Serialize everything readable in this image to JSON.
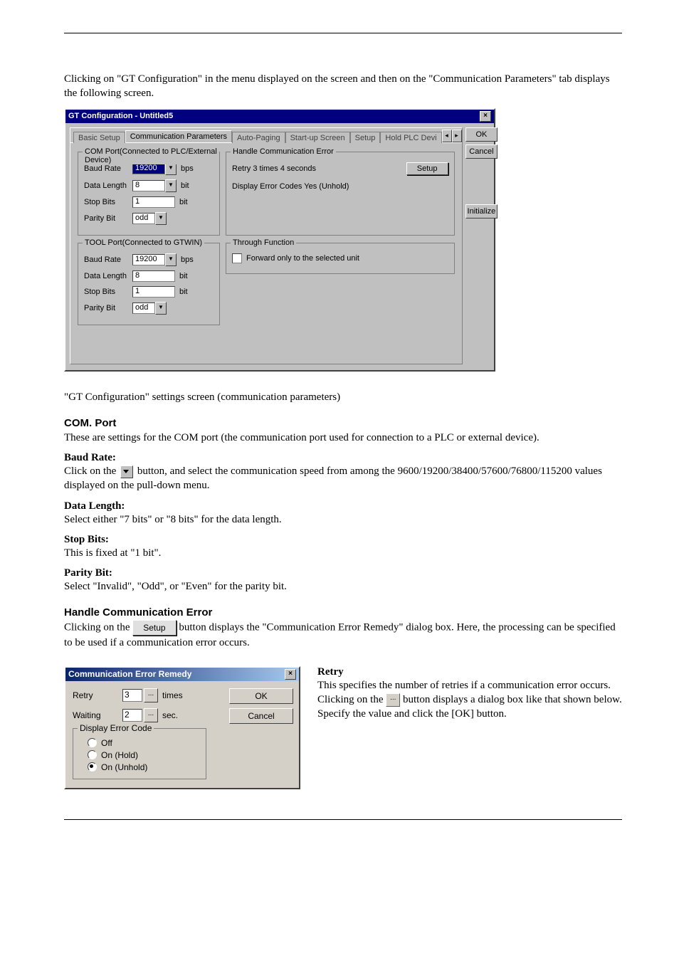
{
  "intro": {
    "p1": "Clicking on \"GT Configuration\" in the menu displayed on the screen and then on the \"Communication Parameters\" tab displays the following screen.",
    "caption": "\"GT Configuration\" settings screen (communication parameters)"
  },
  "dialog1": {
    "title": "GT Configuration - Untitled5",
    "tabs": [
      "Basic Setup",
      "Communication Parameters",
      "Auto-Paging",
      "Start-up Screen",
      "Setup",
      "Hold PLC Devi"
    ],
    "btn_ok": "OK",
    "btn_cancel": "Cancel",
    "btn_init": "Initialize",
    "com_port": {
      "legend": "COM Port(Connected to PLC/External Device)",
      "baud_lbl": "Baud Rate",
      "baud_val": "19200",
      "baud_unit": "bps",
      "data_lbl": "Data Length",
      "data_val": "8",
      "data_unit": "bit",
      "stop_lbl": "Stop Bits",
      "stop_val": "1",
      "stop_unit": "bit",
      "parity_lbl": "Parity Bit",
      "parity_val": "odd"
    },
    "err_group": {
      "legend": "Handle Communication Error",
      "retry_line": "Retry   3 times   4 seconds",
      "display_line": "Display Error Codes  Yes (Unhold)",
      "setup_btn": "Setup"
    },
    "tool_port": {
      "legend": "TOOL Port(Connected to GTWIN)",
      "baud_lbl": "Baud Rate",
      "baud_val": "19200",
      "baud_unit": "bps",
      "data_lbl": "Data Length",
      "data_val": "8",
      "data_unit": "bit",
      "stop_lbl": "Stop Bits",
      "stop_val": "1",
      "stop_unit": "bit",
      "parity_lbl": "Parity Bit",
      "parity_val": "odd"
    },
    "through": {
      "legend": "Through Function",
      "chk_label": "Forward only to the selected unit"
    }
  },
  "comport_section": {
    "head": "COM. Port",
    "p": "These are settings for the COM port (the communication port used for connection to a PLC or external device).",
    "baud_head": "Baud Rate:",
    "baud_p_a": "Click on the ",
    "baud_p_b": " button, and select the communication speed from among the 9600/19200/38400/57600/76800/115200 values displayed on the pull-down menu.",
    "datalen_head": "Data Length:",
    "datalen_p": "Select either \"7 bits\" or \"8 bits\" for the data length.",
    "stop_head": "Stop Bits:",
    "stop_p": "This is fixed at \"1 bit\".",
    "parity_head": "Parity Bit:",
    "parity_p": "Select \"Invalid\", \"Odd\", or \"Even\" for the parity bit."
  },
  "err_section": {
    "head": "Handle Communication Error",
    "p_a": "Clicking on the ",
    "p_b": " button displays the \"Communication Error Remedy\" dialog box. Here, the processing can be specified to be used if a communication error occurs."
  },
  "dialog2": {
    "title": "Communication Error Remedy",
    "retry_lbl": "Retry",
    "retry_val": "3",
    "retry_unit": "times",
    "wait_lbl": "Waiting",
    "wait_val": "2",
    "wait_unit": "sec.",
    "group_legend": "Display Error Code",
    "opt_off": "Off",
    "opt_hold": "On (Hold)",
    "opt_unhold": "On (Unhold)",
    "btn_ok": "OK",
    "btn_cancel": "Cancel"
  },
  "retry_text": {
    "head": "Retry",
    "p_a": "This specifies the number of retries if a communication error occurs. Clicking on the ",
    "p_b": " button displays a dialog box like that shown below. Specify the value and click the [OK] button."
  }
}
